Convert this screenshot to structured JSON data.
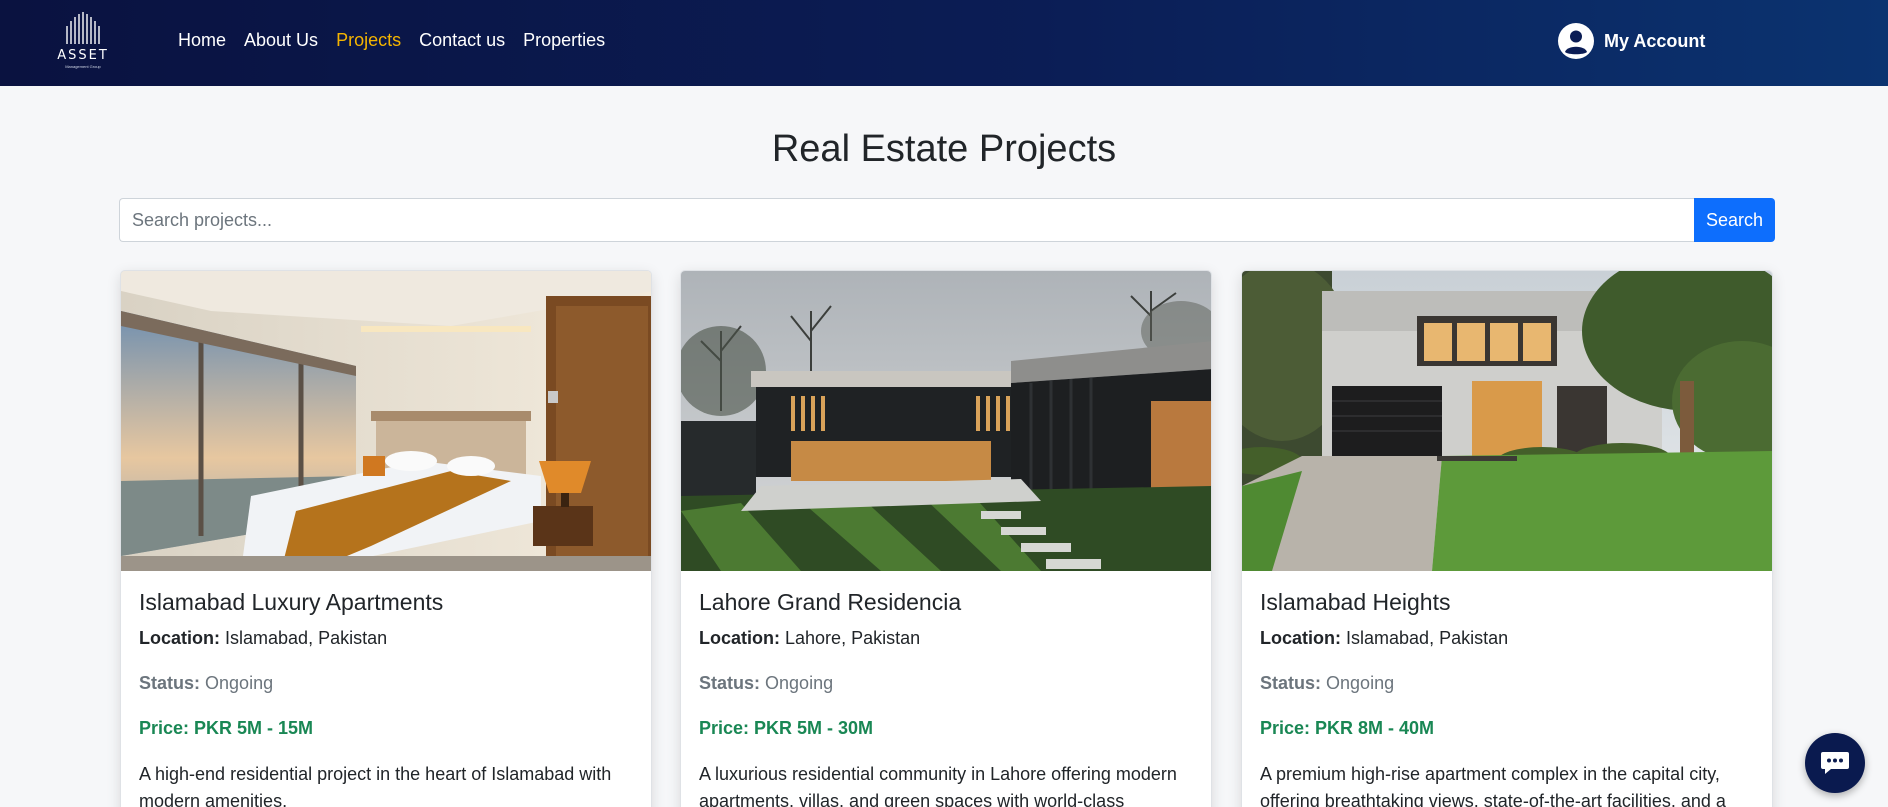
{
  "brand": {
    "logo_word": "ASSET",
    "logo_subtitle": "Management Group"
  },
  "nav": {
    "links": [
      {
        "label": "Home"
      },
      {
        "label": "About Us"
      },
      {
        "label": "Projects",
        "active": true
      },
      {
        "label": "Contact us"
      },
      {
        "label": "Properties"
      }
    ],
    "account_label": "My Account",
    "active_color": "#f4b400"
  },
  "main": {
    "title": "Real Estate Projects",
    "search": {
      "placeholder": "Search projects...",
      "value": "",
      "button_label": "Search"
    }
  },
  "projects": [
    {
      "title": "Islamabad Luxury Apartments",
      "location_label": "Location:",
      "location": "Islamabad, Pakistan",
      "status_label": "Status:",
      "status": "Ongoing",
      "price": "Price: PKR 5M - 15M",
      "description": "A high-end residential project in the heart of Islamabad with modern amenities."
    },
    {
      "title": "Lahore Grand Residencia",
      "location_label": "Location:",
      "location": "Lahore, Pakistan",
      "status_label": "Status:",
      "status": "Ongoing",
      "price": "Price: PKR 5M - 30M",
      "description": "A luxurious residential community in Lahore offering modern apartments, villas, and green spaces with world-class"
    },
    {
      "title": "Islamabad Heights",
      "location_label": "Location:",
      "location": "Islamabad, Pakistan",
      "status_label": "Status:",
      "status": "Ongoing",
      "price": "Price: PKR 8M - 40M",
      "description": "A premium high-rise apartment complex in the capital city, offering breathtaking views, state-of-the-art facilities, and a"
    }
  ],
  "colors": {
    "nav_bg": "#0b1d55",
    "primary": "#0d6efd",
    "price": "#198754"
  }
}
